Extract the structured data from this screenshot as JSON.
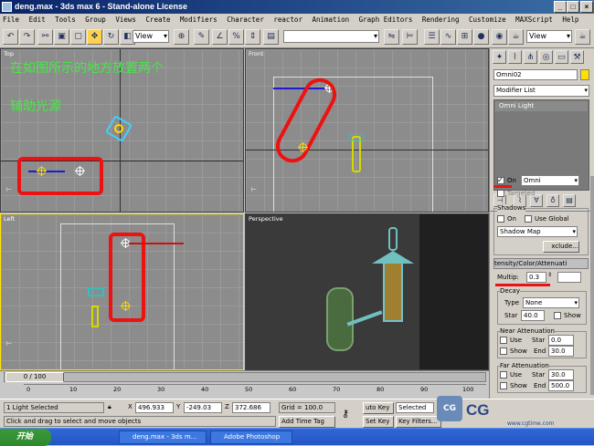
{
  "title": "deng.max - 3ds max 6 - Stand-alone License",
  "menu": [
    "File",
    "Edit",
    "Tools",
    "Group",
    "Views",
    "Create",
    "Modifiers",
    "Character",
    "reactor",
    "Animation",
    "Graph Editors",
    "Rendering",
    "Customize",
    "MAXScript",
    "Help"
  ],
  "toolbar": {
    "view_select_1": "View",
    "view_select_2": "View"
  },
  "viewports": {
    "top": {
      "label": "Top"
    },
    "front": {
      "label": "Front"
    },
    "left": {
      "label": "Left"
    },
    "perspective": {
      "label": "Perspective"
    }
  },
  "annotation": {
    "line1": "在如图所示的地方放置两个",
    "line2": "辅助光源"
  },
  "command_panel": {
    "object_name": "Omni02",
    "modifier_list": "Modifier List",
    "stack_item": "Omni Light",
    "on_label": "On",
    "light_type": "Omni",
    "targeted_label": "Targeted",
    "shadows_title": "Shadows",
    "shadows_on": "On",
    "use_global": "Use Global",
    "shadow_type": "Shadow Map",
    "exclude_btn": "xclude...",
    "intensity_title": "tensity/Color/Attenuati",
    "multiplier_label": "Multip:",
    "multiplier_value": "0.3",
    "decay_title": "Decay",
    "decay_type_label": "Type",
    "decay_type_value": "None",
    "decay_start_label": "Star",
    "decay_start_value": "40.0",
    "decay_show": "Show",
    "near_title": "Near Attenuation",
    "near_use": "Use",
    "near_show": "Show",
    "near_start_label": "Star",
    "near_start_value": "0.0",
    "near_end_label": "End",
    "near_end_value": "30.0",
    "far_title": "Far Attenuation",
    "far_use": "Use",
    "far_show": "Show",
    "far_start_label": "Star",
    "far_start_value": "30.0",
    "far_end_label": "End",
    "far_end_value": "500.0"
  },
  "timeline": {
    "slider_label": "0 / 100",
    "ticks": [
      "0",
      "10",
      "20",
      "30",
      "40",
      "50",
      "60",
      "70",
      "80",
      "90",
      "100"
    ]
  },
  "status": {
    "selection": "1 Light Selected",
    "prompt": "Click and drag to select and move objects",
    "x_label": "X",
    "x_value": "496.933",
    "y_label": "Y",
    "y_value": "-249.03",
    "z_label": "Z",
    "z_value": "372.686",
    "grid": "Grid = 100.0",
    "add_time_tag": "Add Time Tag",
    "auto_key": "uto Key",
    "selected": "Selected",
    "set_key": "Set Key",
    "key_filters": "Key Filters..."
  },
  "taskbar": {
    "start": "开始",
    "task1": "deng.max - 3ds m...",
    "task2": "Adobe Photoshop"
  },
  "watermark": {
    "brand": "CG",
    "url": "www.cgtime.com"
  },
  "colors": {
    "highlight_red": "#ee1111",
    "annotation_green": "#46e846",
    "title_blue": "#0a246a"
  }
}
